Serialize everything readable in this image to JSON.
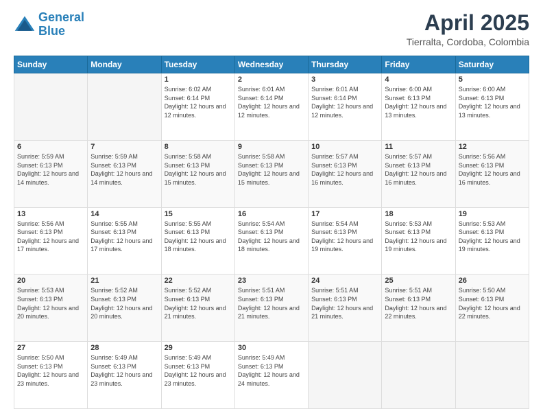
{
  "header": {
    "logo_general": "General",
    "logo_blue": "Blue",
    "month_title": "April 2025",
    "location": "Tierralta, Cordoba, Colombia"
  },
  "weekdays": [
    "Sunday",
    "Monday",
    "Tuesday",
    "Wednesday",
    "Thursday",
    "Friday",
    "Saturday"
  ],
  "weeks": [
    [
      {
        "day": null,
        "info": null
      },
      {
        "day": null,
        "info": null
      },
      {
        "day": "1",
        "sunrise": "Sunrise: 6:02 AM",
        "sunset": "Sunset: 6:14 PM",
        "daylight": "Daylight: 12 hours and 12 minutes."
      },
      {
        "day": "2",
        "sunrise": "Sunrise: 6:01 AM",
        "sunset": "Sunset: 6:14 PM",
        "daylight": "Daylight: 12 hours and 12 minutes."
      },
      {
        "day": "3",
        "sunrise": "Sunrise: 6:01 AM",
        "sunset": "Sunset: 6:14 PM",
        "daylight": "Daylight: 12 hours and 12 minutes."
      },
      {
        "day": "4",
        "sunrise": "Sunrise: 6:00 AM",
        "sunset": "Sunset: 6:13 PM",
        "daylight": "Daylight: 12 hours and 13 minutes."
      },
      {
        "day": "5",
        "sunrise": "Sunrise: 6:00 AM",
        "sunset": "Sunset: 6:13 PM",
        "daylight": "Daylight: 12 hours and 13 minutes."
      }
    ],
    [
      {
        "day": "6",
        "sunrise": "Sunrise: 5:59 AM",
        "sunset": "Sunset: 6:13 PM",
        "daylight": "Daylight: 12 hours and 14 minutes."
      },
      {
        "day": "7",
        "sunrise": "Sunrise: 5:59 AM",
        "sunset": "Sunset: 6:13 PM",
        "daylight": "Daylight: 12 hours and 14 minutes."
      },
      {
        "day": "8",
        "sunrise": "Sunrise: 5:58 AM",
        "sunset": "Sunset: 6:13 PM",
        "daylight": "Daylight: 12 hours and 15 minutes."
      },
      {
        "day": "9",
        "sunrise": "Sunrise: 5:58 AM",
        "sunset": "Sunset: 6:13 PM",
        "daylight": "Daylight: 12 hours and 15 minutes."
      },
      {
        "day": "10",
        "sunrise": "Sunrise: 5:57 AM",
        "sunset": "Sunset: 6:13 PM",
        "daylight": "Daylight: 12 hours and 16 minutes."
      },
      {
        "day": "11",
        "sunrise": "Sunrise: 5:57 AM",
        "sunset": "Sunset: 6:13 PM",
        "daylight": "Daylight: 12 hours and 16 minutes."
      },
      {
        "day": "12",
        "sunrise": "Sunrise: 5:56 AM",
        "sunset": "Sunset: 6:13 PM",
        "daylight": "Daylight: 12 hours and 16 minutes."
      }
    ],
    [
      {
        "day": "13",
        "sunrise": "Sunrise: 5:56 AM",
        "sunset": "Sunset: 6:13 PM",
        "daylight": "Daylight: 12 hours and 17 minutes."
      },
      {
        "day": "14",
        "sunrise": "Sunrise: 5:55 AM",
        "sunset": "Sunset: 6:13 PM",
        "daylight": "Daylight: 12 hours and 17 minutes."
      },
      {
        "day": "15",
        "sunrise": "Sunrise: 5:55 AM",
        "sunset": "Sunset: 6:13 PM",
        "daylight": "Daylight: 12 hours and 18 minutes."
      },
      {
        "day": "16",
        "sunrise": "Sunrise: 5:54 AM",
        "sunset": "Sunset: 6:13 PM",
        "daylight": "Daylight: 12 hours and 18 minutes."
      },
      {
        "day": "17",
        "sunrise": "Sunrise: 5:54 AM",
        "sunset": "Sunset: 6:13 PM",
        "daylight": "Daylight: 12 hours and 19 minutes."
      },
      {
        "day": "18",
        "sunrise": "Sunrise: 5:53 AM",
        "sunset": "Sunset: 6:13 PM",
        "daylight": "Daylight: 12 hours and 19 minutes."
      },
      {
        "day": "19",
        "sunrise": "Sunrise: 5:53 AM",
        "sunset": "Sunset: 6:13 PM",
        "daylight": "Daylight: 12 hours and 19 minutes."
      }
    ],
    [
      {
        "day": "20",
        "sunrise": "Sunrise: 5:53 AM",
        "sunset": "Sunset: 6:13 PM",
        "daylight": "Daylight: 12 hours and 20 minutes."
      },
      {
        "day": "21",
        "sunrise": "Sunrise: 5:52 AM",
        "sunset": "Sunset: 6:13 PM",
        "daylight": "Daylight: 12 hours and 20 minutes."
      },
      {
        "day": "22",
        "sunrise": "Sunrise: 5:52 AM",
        "sunset": "Sunset: 6:13 PM",
        "daylight": "Daylight: 12 hours and 21 minutes."
      },
      {
        "day": "23",
        "sunrise": "Sunrise: 5:51 AM",
        "sunset": "Sunset: 6:13 PM",
        "daylight": "Daylight: 12 hours and 21 minutes."
      },
      {
        "day": "24",
        "sunrise": "Sunrise: 5:51 AM",
        "sunset": "Sunset: 6:13 PM",
        "daylight": "Daylight: 12 hours and 21 minutes."
      },
      {
        "day": "25",
        "sunrise": "Sunrise: 5:51 AM",
        "sunset": "Sunset: 6:13 PM",
        "daylight": "Daylight: 12 hours and 22 minutes."
      },
      {
        "day": "26",
        "sunrise": "Sunrise: 5:50 AM",
        "sunset": "Sunset: 6:13 PM",
        "daylight": "Daylight: 12 hours and 22 minutes."
      }
    ],
    [
      {
        "day": "27",
        "sunrise": "Sunrise: 5:50 AM",
        "sunset": "Sunset: 6:13 PM",
        "daylight": "Daylight: 12 hours and 23 minutes."
      },
      {
        "day": "28",
        "sunrise": "Sunrise: 5:49 AM",
        "sunset": "Sunset: 6:13 PM",
        "daylight": "Daylight: 12 hours and 23 minutes."
      },
      {
        "day": "29",
        "sunrise": "Sunrise: 5:49 AM",
        "sunset": "Sunset: 6:13 PM",
        "daylight": "Daylight: 12 hours and 23 minutes."
      },
      {
        "day": "30",
        "sunrise": "Sunrise: 5:49 AM",
        "sunset": "Sunset: 6:13 PM",
        "daylight": "Daylight: 12 hours and 24 minutes."
      },
      {
        "day": null,
        "info": null
      },
      {
        "day": null,
        "info": null
      },
      {
        "day": null,
        "info": null
      }
    ]
  ]
}
